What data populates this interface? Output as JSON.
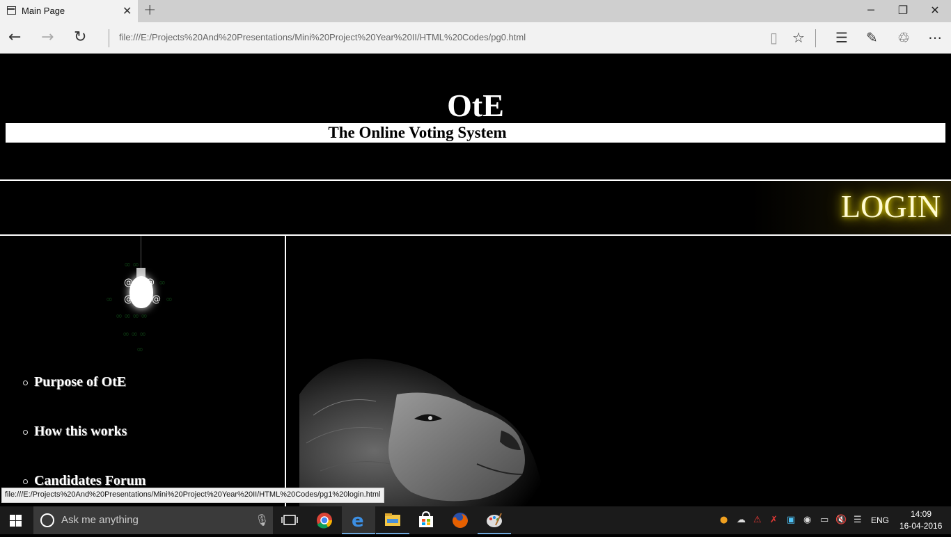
{
  "browser": {
    "tab_title": "Main Page",
    "url": "file:///E:/Projects%20And%20Presentations/Mini%20Project%20Year%20II/HTML%20Codes/pg0.html"
  },
  "page": {
    "logo": "OtE",
    "subtitle": "The Online Voting System",
    "login": "LOGIN",
    "menu": [
      {
        "label": "Purpose of OtE"
      },
      {
        "label": "How this works"
      },
      {
        "label": "Candidates Forum"
      }
    ]
  },
  "status_bar": {
    "link": "file:///E:/Projects%20And%20Presentations/Mini%20Project%20Year%20II/HTML%20Codes/pg1%20login.html"
  },
  "taskbar": {
    "search_placeholder": "Ask me anything",
    "language": "ENG",
    "time": "14:09",
    "date": "16-04-2016"
  },
  "icons": {
    "tab": "page-icon",
    "back": "back-arrow-icon",
    "forward": "forward-arrow-icon",
    "refresh": "refresh-icon",
    "reading_view": "reading-view-icon",
    "favorite": "star-icon",
    "hub": "hub-icon",
    "note": "web-note-icon",
    "share": "share-icon",
    "more": "more-icon"
  }
}
